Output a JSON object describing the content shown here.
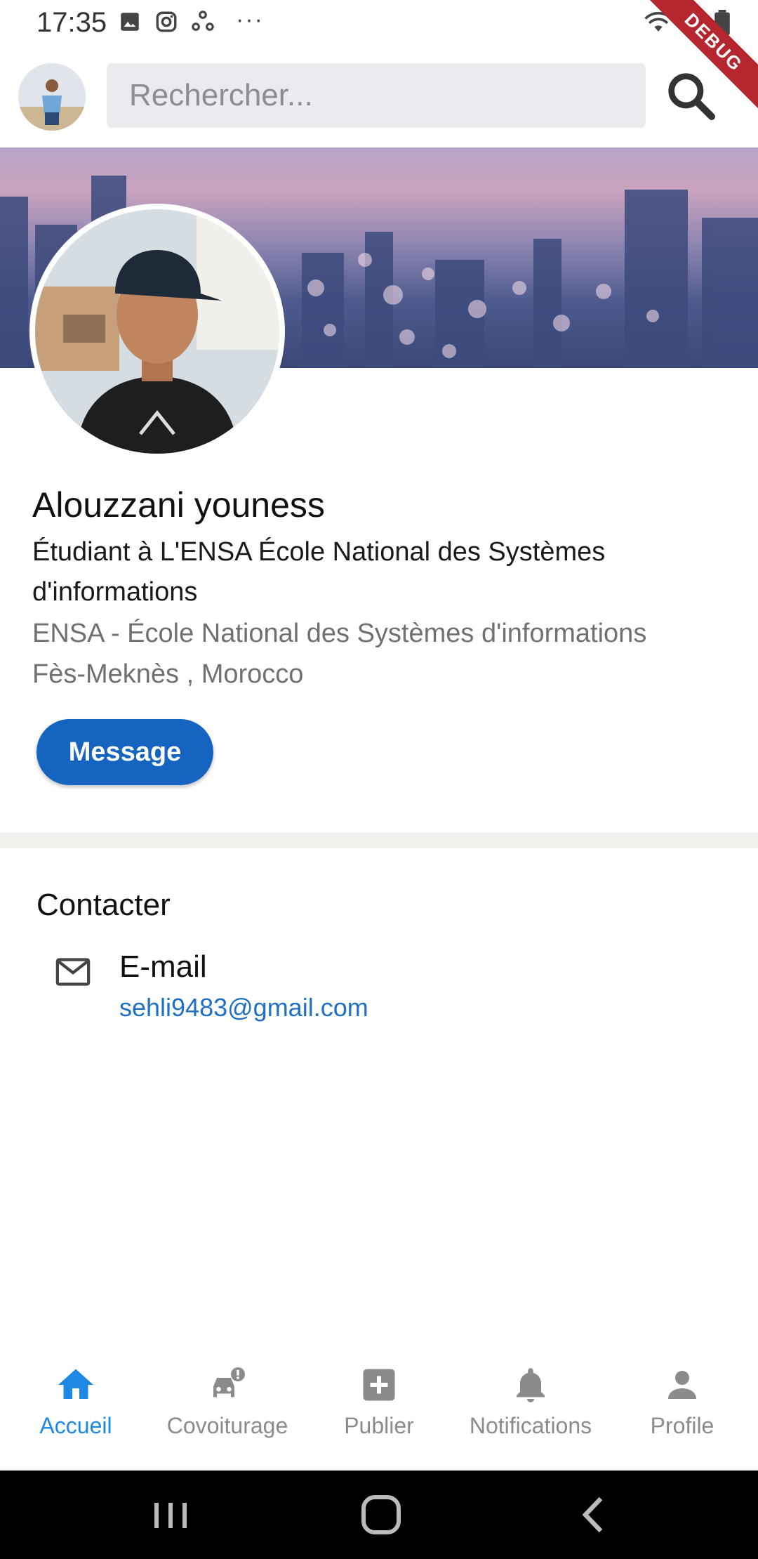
{
  "status_bar": {
    "time": "17:35",
    "left_icons": [
      "image-icon",
      "instagram-icon",
      "sync-icon"
    ],
    "overflow": "···",
    "right_icons": [
      "wifi-icon",
      "signal-icon",
      "battery-icon"
    ]
  },
  "debug_banner": "DEBUG",
  "app_bar": {
    "search_placeholder": "Rechercher...",
    "search_icon": "search-icon"
  },
  "profile": {
    "name": "Alouzzani youness",
    "headline": "Étudiant à L'ENSA École National des Systèmes d'informations",
    "organization": "ENSA - École National des Systèmes d'informations",
    "location": "Fès-Meknès , Morocco",
    "message_button": "Message"
  },
  "contact": {
    "title": "Contacter",
    "email_label": "E-mail",
    "email_value": "sehli9483@gmail.com"
  },
  "bottom_nav": {
    "items": [
      {
        "label": "Accueil",
        "icon": "home-icon",
        "active": true
      },
      {
        "label": "Covoiturage",
        "icon": "car-alert-icon",
        "active": false
      },
      {
        "label": "Publier",
        "icon": "add-box-icon",
        "active": false
      },
      {
        "label": "Notifications",
        "icon": "bell-icon",
        "active": false
      },
      {
        "label": "Profile",
        "icon": "person-icon",
        "active": false
      }
    ]
  },
  "colors": {
    "accent": "#1565c0",
    "nav_active": "#1e88e5",
    "link": "#1f6fc4",
    "secondary_text": "#707070"
  }
}
